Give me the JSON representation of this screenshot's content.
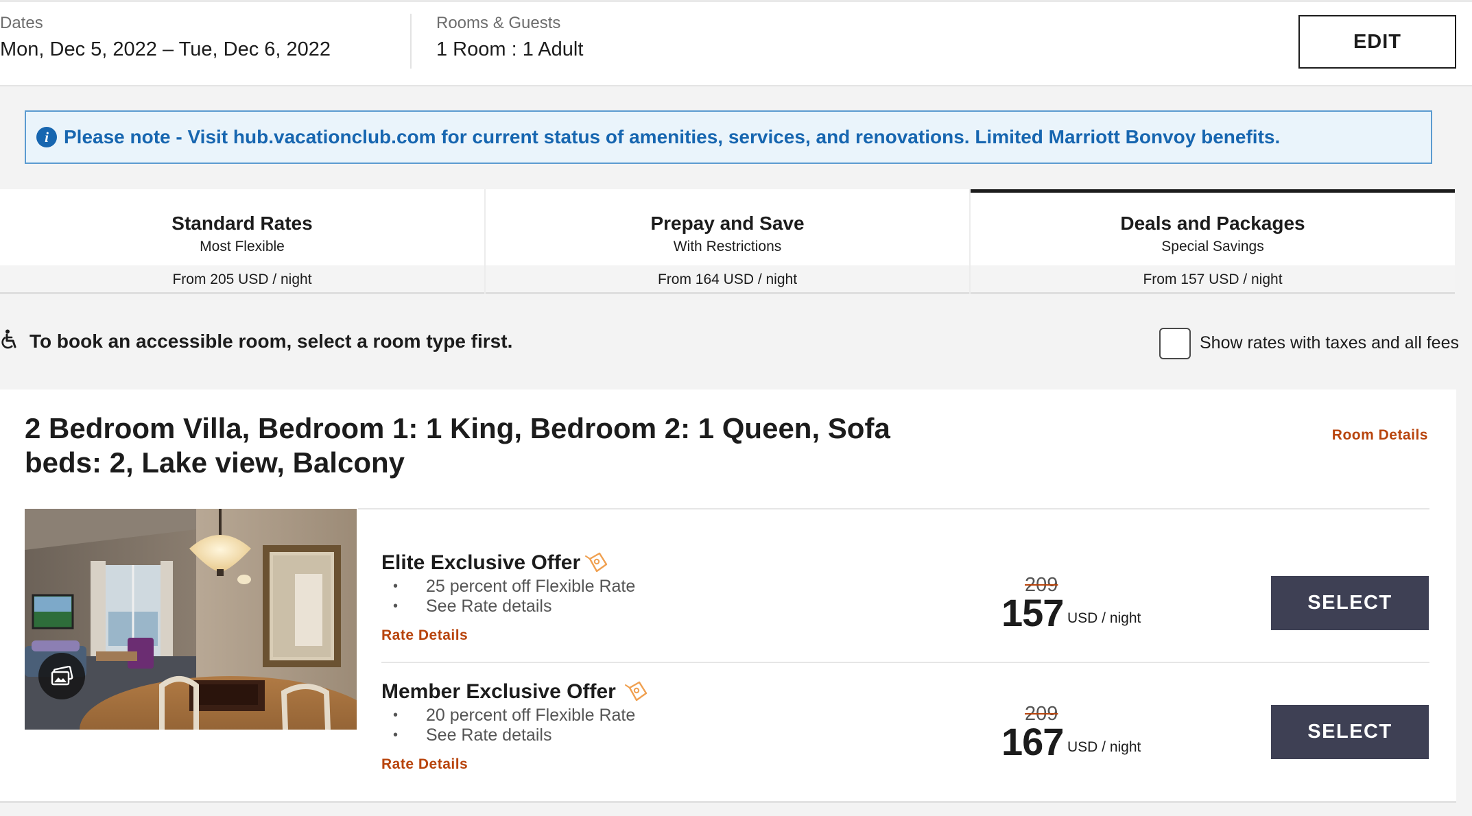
{
  "summary": {
    "dates_label": "Dates",
    "dates_value": "Mon, Dec 5, 2022 – Tue, Dec 6, 2022",
    "guests_label": "Rooms & Guests",
    "guests_value": "1 Room : 1 Adult",
    "edit_label": "EDIT"
  },
  "notice": {
    "icon": "info-icon",
    "text": "Please note - Visit hub.vacationclub.com for current status of amenities, services, and renovations. Limited Marriott Bonvoy benefits."
  },
  "tabs": [
    {
      "title": "Standard Rates",
      "subtitle": "Most Flexible",
      "price": "From 205 USD / night",
      "active": false
    },
    {
      "title": "Prepay and Save",
      "subtitle": "With Restrictions",
      "price": "From 164 USD / night",
      "active": false
    },
    {
      "title": "Deals and Packages",
      "subtitle": "Special Savings",
      "price": "From 157 USD / night",
      "active": true
    }
  ],
  "accessibility": {
    "icon": "wheelchair-icon",
    "text": "To book an accessible room, select a room type first.",
    "tax_toggle_label": "Show rates with taxes and all fees",
    "tax_toggle_checked": false
  },
  "room": {
    "title": "2 Bedroom Villa, Bedroom 1: 1 King, Bedroom 2: 1 Queen, Sofa beds: 2, Lake view, Balcony",
    "details_link": "Room Details",
    "photo_icon": "gallery-icon",
    "offers": [
      {
        "title": "Elite Exclusive Offer",
        "tag_icon": "discount-tag-icon",
        "bullets": [
          "25 percent off Flexible Rate",
          "See Rate details"
        ],
        "rate_details_link": "Rate Details",
        "original_price": "209",
        "price": "157",
        "unit": "USD / night",
        "select_label": "SELECT"
      },
      {
        "title": "Member Exclusive Offer",
        "tag_icon": "discount-tag-icon",
        "bullets": [
          "20 percent off Flexible Rate",
          "See Rate details"
        ],
        "rate_details_link": "Rate Details",
        "original_price": "209",
        "price": "167",
        "unit": "USD / night",
        "select_label": "SELECT"
      }
    ]
  },
  "colors": {
    "link_orange": "#b8440c",
    "notice_blue": "#1766b0",
    "select_button": "#3e4054"
  }
}
